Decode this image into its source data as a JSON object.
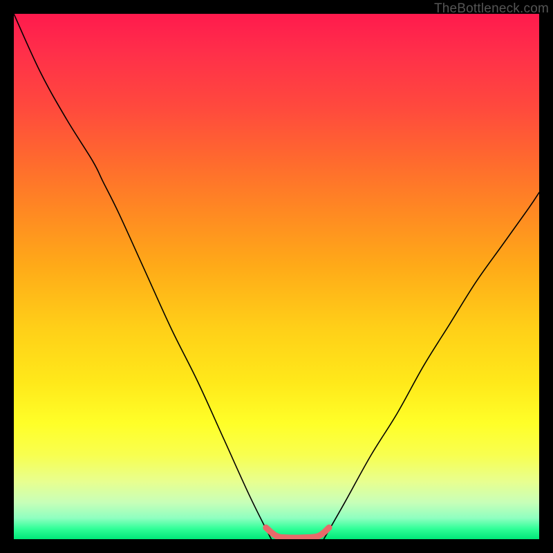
{
  "watermark": "TheBottleneck.com",
  "chart_data": {
    "type": "line",
    "title": "",
    "xlabel": "",
    "ylabel": "",
    "xlim": [
      0,
      100
    ],
    "ylim": [
      0,
      100
    ],
    "grid": false,
    "legend": false,
    "series": [
      {
        "name": "curve-left",
        "stroke": "#000000",
        "x": [
          0,
          5,
          10,
          15,
          17,
          20,
          25,
          30,
          35,
          40,
          45,
          49
        ],
        "y": [
          100,
          89,
          80,
          72,
          68,
          62,
          51,
          40,
          30,
          19,
          8,
          0
        ]
      },
      {
        "name": "curve-right",
        "stroke": "#000000",
        "x": [
          59,
          63,
          68,
          73,
          78,
          83,
          88,
          93,
          98,
          100
        ],
        "y": [
          0,
          7,
          16,
          24,
          33,
          41,
          49,
          56,
          63,
          66
        ]
      },
      {
        "name": "optimal-range",
        "stroke": "#e86a6a",
        "x": [
          48,
          50,
          52,
          55,
          58,
          60
        ],
        "y": [
          2.2,
          0.6,
          0.3,
          0.3,
          0.6,
          2.2
        ]
      }
    ]
  }
}
